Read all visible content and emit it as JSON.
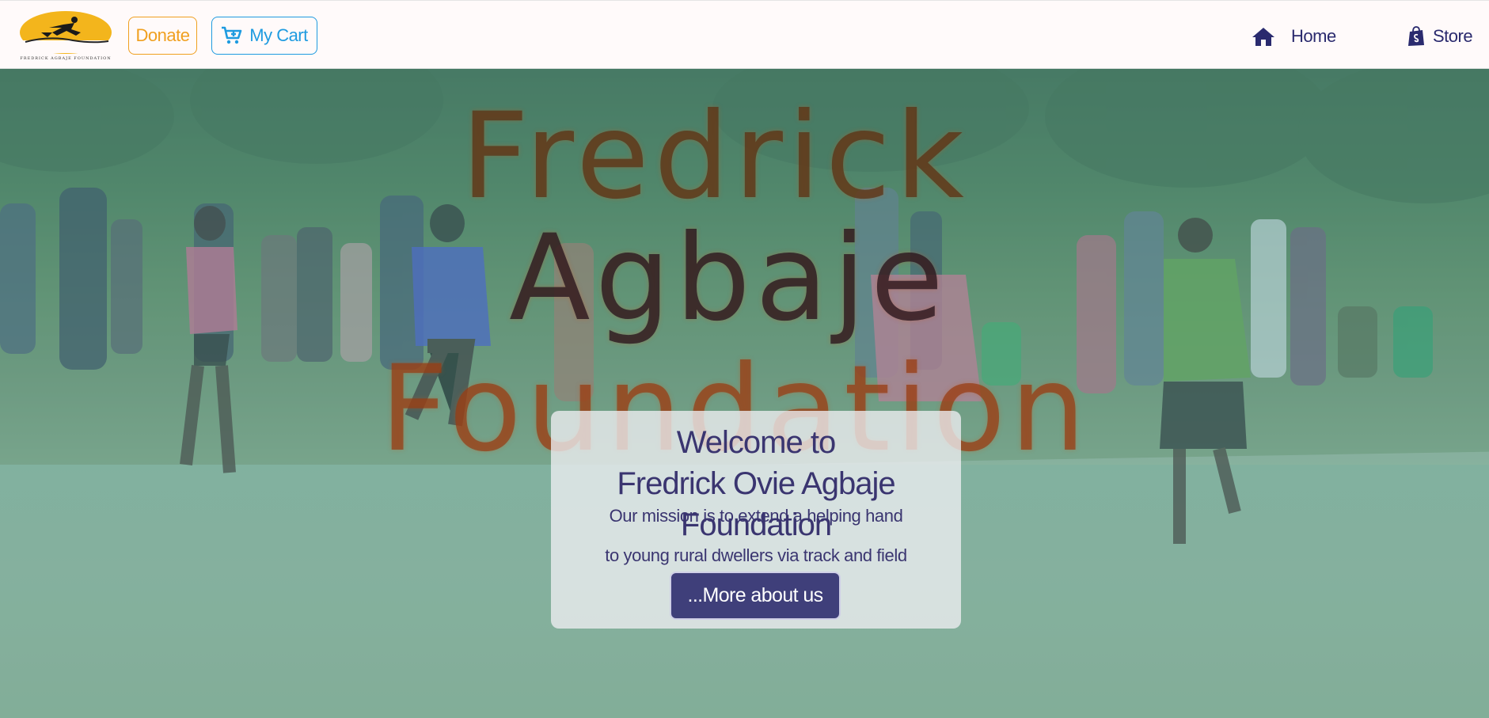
{
  "navbar": {
    "logo_text": "FREDRICK AGBAJE FOUNDATION",
    "donate_label": "Donate",
    "cart_label": "My Cart",
    "home_label": "Home",
    "store_label": "Store"
  },
  "hero": {
    "big_words": [
      "Fredrick",
      "Agbaje",
      "Foundation"
    ],
    "welcome_line1": "Welcome to",
    "welcome_line2": "Fredrick Ovie Agbaje Foundation",
    "mission_line1": "Our mission is to extend a helping hand",
    "mission_line2": "to young rural dwellers via track and field",
    "more_button": "...More about us"
  },
  "colors": {
    "donate": "#f0a020",
    "cart": "#1e9be0",
    "nav_text": "#2a2a6e",
    "card_text": "#3a3570",
    "more_button_bg": "#3f3f7a"
  },
  "icons": {
    "home": "home-icon",
    "store": "shopify-bag-icon",
    "cart": "cart-plus-icon"
  }
}
